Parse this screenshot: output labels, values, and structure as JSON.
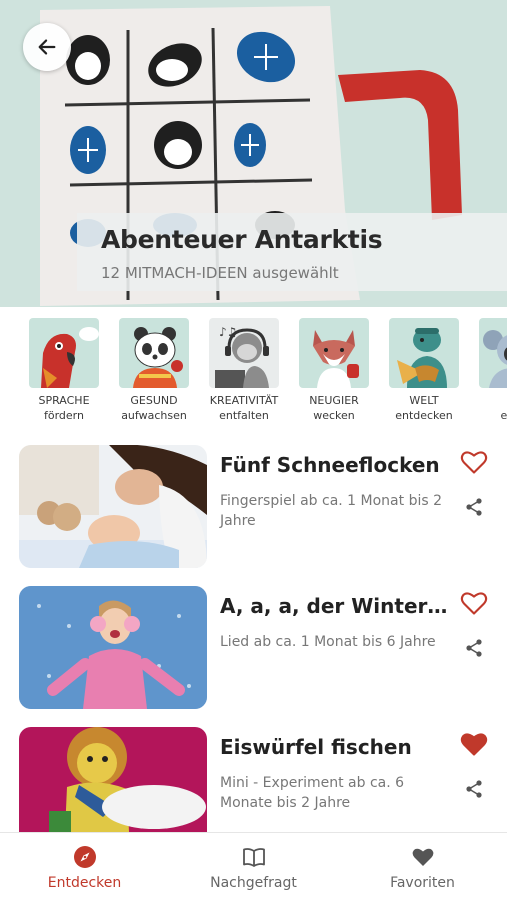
{
  "colors": {
    "accent": "#c0392b",
    "hero_bg": "#cfe3dd",
    "category_bg": "#c9e3dc",
    "heart": "#c0392b"
  },
  "hero": {
    "title": "Abenteuer Antarktis",
    "subtitle": "12 MITMACH-IDEEN ausgewählt",
    "back_icon": "arrow-left-icon"
  },
  "categories": [
    {
      "line1": "SPRACHE",
      "line2": "fördern",
      "icon": "parrot-icon"
    },
    {
      "line1": "GESUND",
      "line2": "aufwachsen",
      "icon": "panda-icon"
    },
    {
      "line1": "KREATIVITÄT",
      "line2": "entfalten",
      "icon": "monkey-music-icon"
    },
    {
      "line1": "NEUGIER",
      "line2": "wecken",
      "icon": "fox-icon"
    },
    {
      "line1": "WELT",
      "line2": "entdecken",
      "icon": "turtle-icon"
    },
    {
      "line1": "WI",
      "line2": "entw",
      "icon": "koala-icon"
    }
  ],
  "items": [
    {
      "title": "Fünf Schneeflocken",
      "desc": "Fingerspiel ab ca. 1 Monat bis 2 Jahre",
      "favorite": false
    },
    {
      "title": "A, a, a, der Winter…",
      "desc": "Lied ab ca. 1 Monat bis 6 Jahre",
      "favorite": false
    },
    {
      "title": "Eiswürfel fischen",
      "desc": "Mini - Experiment ab ca. 6 Monate bis 2 Jahre",
      "favorite": true
    }
  ],
  "nav": [
    {
      "label": "Entdecken",
      "icon": "compass-icon",
      "active": true
    },
    {
      "label": "Nachgefragt",
      "icon": "book-icon",
      "active": false
    },
    {
      "label": "Favoriten",
      "icon": "heart-icon",
      "active": false
    }
  ]
}
